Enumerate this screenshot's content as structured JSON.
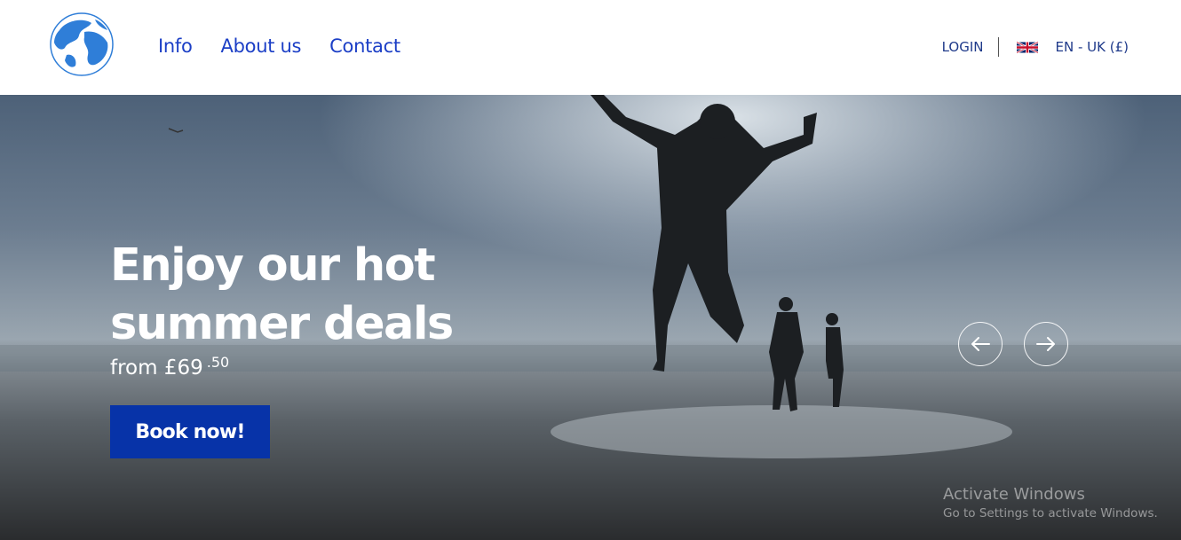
{
  "header": {
    "logo_icon": "globe-icon",
    "nav": [
      {
        "label": "Info"
      },
      {
        "label": "About us"
      },
      {
        "label": "Contact"
      }
    ],
    "login_label": "LOGIN",
    "flag_icon": "uk-flag-icon",
    "language_label": "EN - UK (£)"
  },
  "hero": {
    "headline": "Enjoy our hot summer deals",
    "price_prefix": "from £69",
    "price_cents": ".50",
    "book_label": "Book now!",
    "prev_icon": "arrow-left-icon",
    "next_icon": "arrow-right-icon"
  },
  "watermark": {
    "title": "Activate Windows",
    "subtitle": "Go to Settings to activate Windows."
  },
  "colors": {
    "nav_link": "#1c3fc6",
    "button": "#0733a8",
    "accent_dark": "#1f3a8a"
  }
}
